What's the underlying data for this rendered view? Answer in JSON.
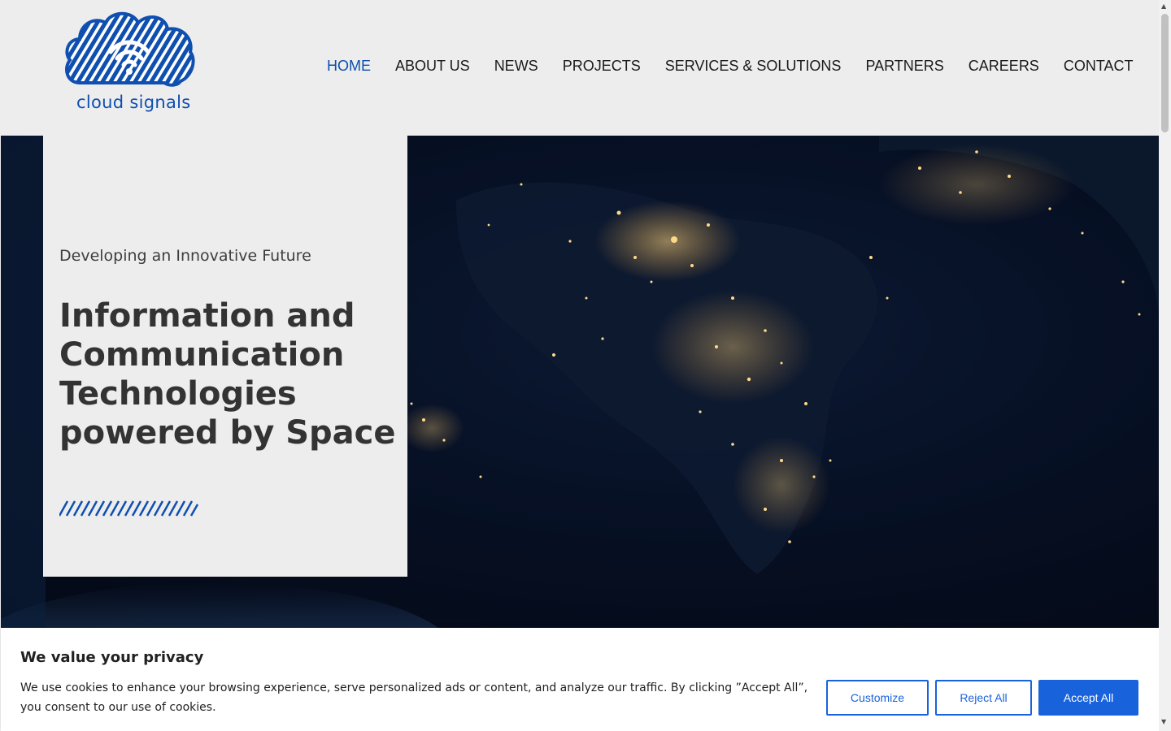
{
  "brand": {
    "name": "cloud signals"
  },
  "nav": {
    "items": [
      {
        "label": "HOME",
        "active": true
      },
      {
        "label": "ABOUT US"
      },
      {
        "label": "NEWS"
      },
      {
        "label": "PROJECTS"
      },
      {
        "label": "SERVICES & SOLUTIONS"
      },
      {
        "label": "PARTNERS"
      },
      {
        "label": "CAREERS"
      },
      {
        "label": "CONTACT"
      }
    ]
  },
  "hero": {
    "tagline": "Developing an Innovative Future",
    "headline": "Information and Communication Technologies powered by Space"
  },
  "cookie": {
    "title": "We value your privacy",
    "text": "We use cookies to enhance your browsing experience, serve personalized ads or content, and analyze our traffic. By clicking ”Accept All”, you consent to our use of cookies.",
    "customize": "Customize",
    "reject": "Reject All",
    "accept": "Accept All"
  },
  "colors": {
    "brand_blue": "#0f4fb0",
    "nav_active": "#0b4fae",
    "button_blue": "#1863dc",
    "header_bg": "#ededed",
    "hero_bg": "#071126"
  },
  "icons": {
    "logo": "cloud-wifi-logo-icon"
  }
}
